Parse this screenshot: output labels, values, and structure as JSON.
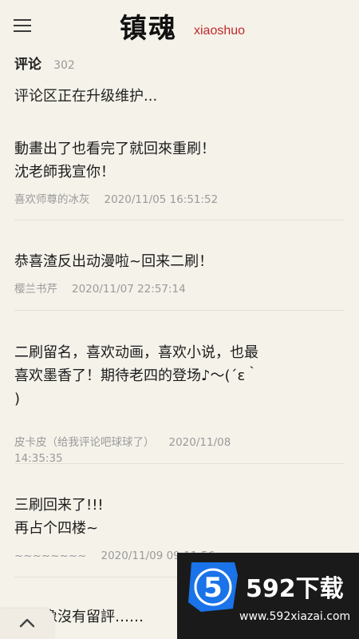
{
  "header": {
    "brand_cn": "镇魂",
    "brand_en": "xiaoshuo",
    "menu_icon": "hamburger-menu-icon"
  },
  "comments_section": {
    "title": "评论",
    "count": "302",
    "notice": "评论区正在升级维护..."
  },
  "comments": [
    {
      "text": "動畫出了也看完了就回來重刷！\n沈老師我宣你！",
      "user": "喜欢师尊的冰灰",
      "time": "2020/11/05 16:51:52"
    },
    {
      "text": "恭喜渣反出动漫啦~回来二刷！",
      "user": "樱兰书芹",
      "time": "2020/11/07 22:57:14"
    },
    {
      "text": "二刷留名，喜欢动画，喜欢小说，也最\n喜欢墨香了！期待老四的登场♪～(´ε｀\n)",
      "user": "皮卡皮（给我评论吧球球了）",
      "time": "2020/11/08\n14:35:35"
    },
    {
      "text": "三刷回来了!!!\n再占个四楼~",
      "user": "~~~~~~~~",
      "time": "2020/11/09 09:11:56"
    },
    {
      "text": "前好像沒有留評……",
      "user": "",
      "time": ""
    }
  ],
  "scroll_top_icon": "chevron-up-icon",
  "watermark": {
    "logo_text": "5",
    "title": "592下载",
    "url": "www.592xiazai.com",
    "colors": {
      "blue": "#1a73e8",
      "dark": "#1a1a1a"
    }
  }
}
